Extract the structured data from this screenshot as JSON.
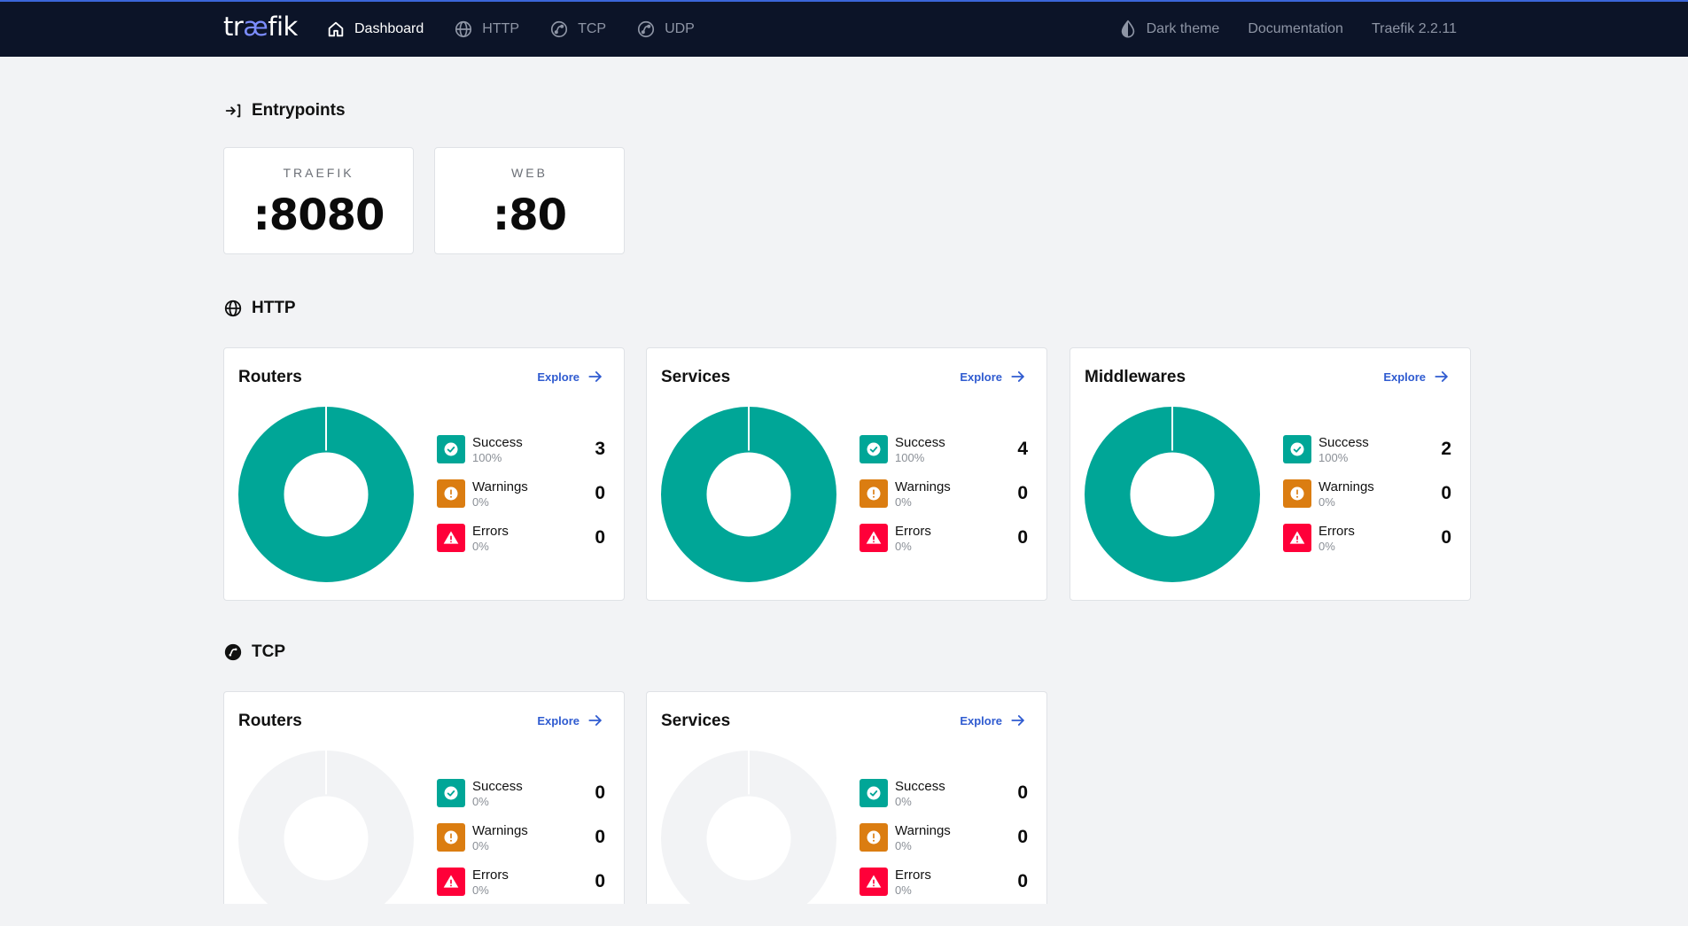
{
  "nav": {
    "logo": {
      "prefix": "tr",
      "accent": "æ",
      "suffix": "fik"
    },
    "left": [
      {
        "label": "Dashboard",
        "icon": "home-icon",
        "active": true
      },
      {
        "label": "HTTP",
        "icon": "globe-icon",
        "active": false
      },
      {
        "label": "TCP",
        "icon": "tcp-icon",
        "active": false
      },
      {
        "label": "UDP",
        "icon": "udp-icon",
        "active": false
      }
    ],
    "right": [
      {
        "label": "Dark theme",
        "icon": "contrast-icon"
      },
      {
        "label": "Documentation"
      },
      {
        "label": "Traefik 2.2.11"
      }
    ]
  },
  "entrypoints": {
    "title": "Entrypoints",
    "items": [
      {
        "name": "TRAEFIK",
        "port": ":8080"
      },
      {
        "name": "WEB",
        "port": ":80"
      }
    ]
  },
  "http": {
    "title": "HTTP",
    "cards": [
      {
        "title": "Routers",
        "explore": "Explore",
        "success": {
          "label": "Success",
          "pct": "100%",
          "count": "3"
        },
        "warnings": {
          "label": "Warnings",
          "pct": "0%",
          "count": "0"
        },
        "errors": {
          "label": "Errors",
          "pct": "0%",
          "count": "0"
        }
      },
      {
        "title": "Services",
        "explore": "Explore",
        "success": {
          "label": "Success",
          "pct": "100%",
          "count": "4"
        },
        "warnings": {
          "label": "Warnings",
          "pct": "0%",
          "count": "0"
        },
        "errors": {
          "label": "Errors",
          "pct": "0%",
          "count": "0"
        }
      },
      {
        "title": "Middlewares",
        "explore": "Explore",
        "success": {
          "label": "Success",
          "pct": "100%",
          "count": "2"
        },
        "warnings": {
          "label": "Warnings",
          "pct": "0%",
          "count": "0"
        },
        "errors": {
          "label": "Errors",
          "pct": "0%",
          "count": "0"
        }
      }
    ]
  },
  "tcp": {
    "title": "TCP",
    "cards": [
      {
        "title": "Routers",
        "explore": "Explore",
        "success": {
          "label": "Success",
          "pct": "0%",
          "count": "0"
        },
        "warnings": {
          "label": "Warnings",
          "pct": "0%",
          "count": "0"
        },
        "errors": {
          "label": "Errors",
          "pct": "0%",
          "count": "0"
        }
      },
      {
        "title": "Services",
        "explore": "Explore",
        "success": {
          "label": "Success",
          "pct": "0%",
          "count": "0"
        },
        "warnings": {
          "label": "Warnings",
          "pct": "0%",
          "count": "0"
        },
        "errors": {
          "label": "Errors",
          "pct": "0%",
          "count": "0"
        }
      }
    ]
  },
  "colors": {
    "success": "#00a697",
    "warning": "#db7d11",
    "error": "#ff0039",
    "empty": "#f2f3f5",
    "link": "#2f5bd0",
    "navbar": "#0c1428"
  }
}
